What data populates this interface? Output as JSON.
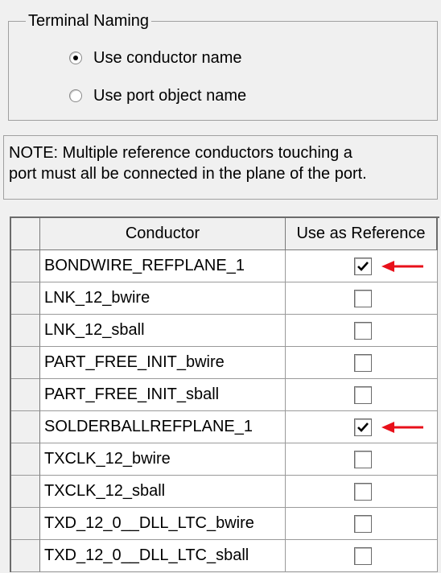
{
  "terminal_naming": {
    "title": "Terminal Naming",
    "options": [
      {
        "label": "Use conductor name",
        "selected": true
      },
      {
        "label": "Use port object name",
        "selected": false
      }
    ]
  },
  "note": {
    "line1": "NOTE: Multiple reference conductors touching a",
    "line2": "port must all be connected in the plane of the port."
  },
  "grid": {
    "headers": {
      "conductor": "Conductor",
      "reference": "Use as Reference"
    },
    "rows": [
      {
        "conductor": "BONDWIRE_REFPLANE_1",
        "checked": true,
        "arrow": true
      },
      {
        "conductor": "LNK_12_bwire",
        "checked": false,
        "arrow": false
      },
      {
        "conductor": "LNK_12_sball",
        "checked": false,
        "arrow": false
      },
      {
        "conductor": "PART_FREE_INIT_bwire",
        "checked": false,
        "arrow": false
      },
      {
        "conductor": "PART_FREE_INIT_sball",
        "checked": false,
        "arrow": false
      },
      {
        "conductor": "SOLDERBALLREFPLANE_1",
        "checked": true,
        "arrow": true
      },
      {
        "conductor": "TXCLK_12_bwire",
        "checked": false,
        "arrow": false
      },
      {
        "conductor": "TXCLK_12_sball",
        "checked": false,
        "arrow": false
      },
      {
        "conductor": "TXD_12_0__DLL_LTC_bwire",
        "checked": false,
        "arrow": false
      },
      {
        "conductor": "TXD_12_0__DLL_LTC_sball",
        "checked": false,
        "arrow": false
      }
    ]
  },
  "colors": {
    "annotation_arrow": "#e8101a",
    "window_bg": "#f0f0f0"
  }
}
